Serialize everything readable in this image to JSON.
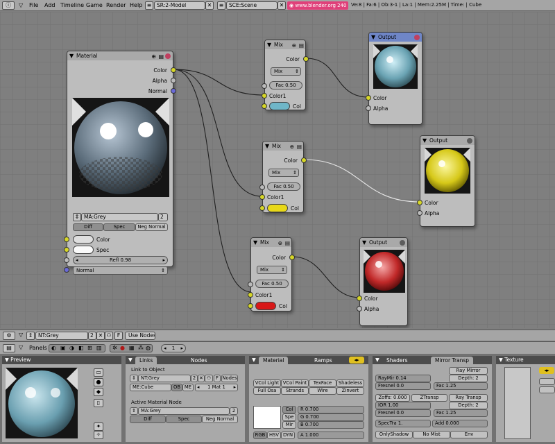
{
  "topbar": {
    "menu": [
      "File",
      "Add",
      "Timeline",
      "Game",
      "Render",
      "Help"
    ],
    "screen": "SR:2-Model",
    "scene": "SCE:Scene",
    "url": "www.blender.org 240",
    "stats": "Ve:8 | Fa:6 | Ob:3-1 | La:1 | Mem:2.25M | Time: | Cube"
  },
  "material_node": {
    "title": "Material",
    "outputs": [
      "Color",
      "Alpha",
      "Normal"
    ],
    "material_name": "MA:Grey",
    "users": "2",
    "toggles": [
      "Diff",
      "Spec",
      "Neg Normal"
    ],
    "inputs": [
      "Color",
      "Spec"
    ],
    "refl": "Refl 0.98",
    "normal": "Normal"
  },
  "mix_nodes": [
    {
      "title": "Mix",
      "output": "Color",
      "mode": "Mix",
      "fac": "Fac 0.50",
      "color1": "Color1",
      "col": "Col",
      "col_hex": "#6fb6c8"
    },
    {
      "title": "Mix",
      "output": "Color",
      "mode": "Mix",
      "fac": "Fac 0.50",
      "color1": "Color1",
      "col": "Col",
      "col_hex": "#e8d818"
    },
    {
      "title": "Mix",
      "output": "Color",
      "mode": "Mix",
      "fac": "Fac 0.50",
      "color1": "Color1",
      "col": "Col",
      "col_hex": "#d81818"
    }
  ],
  "output_nodes": [
    {
      "title": "Output",
      "inputs": [
        "Color",
        "Alpha"
      ]
    },
    {
      "title": "Output",
      "inputs": [
        "Color",
        "Alpha"
      ]
    },
    {
      "title": "Output",
      "inputs": [
        "Color",
        "Alpha"
      ]
    }
  ],
  "node_header": {
    "tree": "NT:Grey",
    "users": "2",
    "f": "F",
    "use_nodes": "Use Nodes"
  },
  "buttons_header": {
    "panels": "Panels",
    "frame": "1"
  },
  "preview_panel": {
    "title": "Preview"
  },
  "links_panel": {
    "tabs": [
      "Links",
      "Nodes"
    ],
    "link_to_object": "Link to Object",
    "tree": "NT:Grey",
    "users": "2",
    "f": "F",
    "nodes_btn": "Nodes",
    "me": "ME:Cube",
    "ob": "OB",
    "me2": "ME",
    "mat": "1 Mat 1",
    "active_node": "Active Material Node",
    "active_mat": "MA:Grey",
    "active_users": "2",
    "toggles": [
      "Diff",
      "Spec",
      "Neg Normal"
    ]
  },
  "material_panel": {
    "tabs": [
      "Material",
      "Ramps"
    ],
    "row1": [
      "VCol Light",
      "VCol Paint",
      "TexFace",
      "Shadeless"
    ],
    "row2": [
      "Full Osa",
      "Strands",
      "Wire",
      "ZInvert"
    ],
    "col_btns": [
      "Col",
      "Spe",
      "Mir"
    ],
    "rgb": [
      "R 0.700",
      "G 0.700",
      "B 0.700"
    ],
    "modes": [
      "RGB",
      "HSV",
      "DYN"
    ],
    "alpha": "A 1.000"
  },
  "shaders_panel": {
    "tabs": [
      "Shaders",
      "Mirror Transp"
    ],
    "ray_mirror": "Ray Mirror",
    "raymir": "RayMir 0.14",
    "depth1": "Depth: 2",
    "fresnel1": "Fresnel 0.0",
    "fac1": "Fac 1.25",
    "zoffs": "Zoffs: 0.000",
    "ztransp": "ZTransp",
    "ray_transp": "Ray Transp",
    "ior": "IOR 1.00",
    "depth2": "Depth: 2",
    "fresnel2": "Fresnel 0.0",
    "fac2": "Fac 1.25",
    "spectra": "SpecTra 1.",
    "add": "Add 0.000",
    "bottom": [
      "OnlyShadow",
      "No Mist",
      "Env"
    ]
  },
  "texture_panel": {
    "title": "Texture"
  },
  "colors": {
    "accent": "#e0407a",
    "socket_color": "#d6d628",
    "socket_normal": "#6a6ad8",
    "output_active": "#6f86c7"
  }
}
